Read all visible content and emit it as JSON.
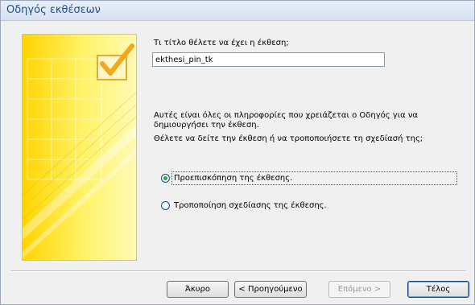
{
  "window": {
    "title": "Οδηγός εκθέσεων"
  },
  "form": {
    "title_prompt": "Τι τίτλο θέλετε να έχει η έκθεση;",
    "title_value": "ekthesi_pin_tk",
    "info_line1": "Αυτές είναι όλες οι πληροφορίες που χρειάζεται ο Οδηγός για να",
    "info_line2": "δημιουργήσει την έκθεση.",
    "question": "Θέλετε να δείτε την έκθεση ή να τροποποιήσετε τη σχεδίασή της;"
  },
  "options": [
    {
      "label": "Προεπισκόπηση της έκθεσης.",
      "selected": true
    },
    {
      "label": "Τροποποίηση σχεδίασης της έκθεσης.",
      "selected": false
    }
  ],
  "buttons": {
    "cancel": "Άκυρο",
    "back": "< Προηγούμενο",
    "next": "Επόμενο >",
    "finish": "Τέλος"
  },
  "colors": {
    "art_yellow": "#ffd400",
    "checkmark": "#f2a81d",
    "radio_selected": "#3aa13a",
    "title_text": "#1f4f8f"
  }
}
